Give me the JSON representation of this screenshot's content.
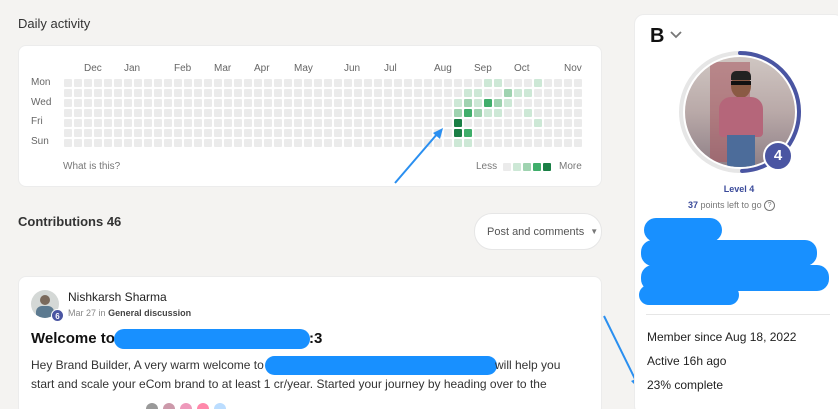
{
  "activity": {
    "title": "Daily activity",
    "months": [
      "Dec",
      "Jan",
      "Feb",
      "Mar",
      "Apr",
      "May",
      "Jun",
      "Jul",
      "Aug",
      "Sep",
      "Oct",
      "Nov"
    ],
    "days": [
      "Mon",
      "Wed",
      "Fri",
      "Sun"
    ],
    "help_link": "What is this?",
    "legend_less": "Less",
    "legend_more": "More",
    "colors": {
      "empty": "#ebebeb",
      "l1": "#cde8d6",
      "l2": "#9fd3b0",
      "l3": "#3fae6a",
      "l4": "#1a7f45"
    }
  },
  "contributions": {
    "label": "Contributions 46",
    "filter_label": "Post and comments"
  },
  "post": {
    "author": "Nishkarsh Sharma",
    "date": "Mar 27",
    "in_text": "in",
    "category": "General discussion",
    "level_badge": "6",
    "title_start": "Welcome to",
    "title_end": ":3",
    "body_line1_start": "Hey Brand Builder, A very warm welcome to",
    "body_line1_end": "will help you",
    "body_line2": "start and scale your eCom brand to at least 1 cr/year. Started your journey by heading over to the"
  },
  "profile": {
    "logo": "B",
    "level_number": "4",
    "level_label": "Level 4",
    "points": "37",
    "points_suffix": "points left to go",
    "member_since": "Member since Aug 18, 2022",
    "active": "Active 16h ago",
    "complete": "23% complete",
    "progress_color": "#4a55a2"
  }
}
